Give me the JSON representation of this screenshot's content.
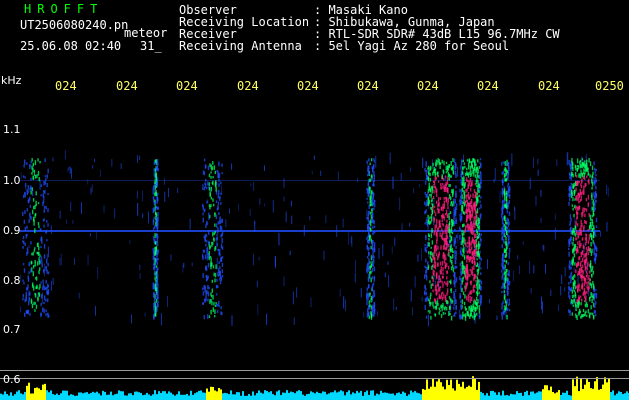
{
  "header": {
    "brand": "HROFFT",
    "filename": "UT2506080240.pn",
    "tag": "meteor",
    "datetime": "25.06.08 02:40",
    "count": "31_",
    "observer_label": "Observer",
    "observer_value": ": Masaki Kano",
    "location_label": "Receiving Location",
    "location_value": ": Shibukawa, Gunma, Japan",
    "receiver_label": "Receiver",
    "receiver_value": ": RTL-SDR SDR# 43dB L15 96.7MHz CW",
    "antenna_label": "Receiving Antenna",
    "antenna_value": ": 5el Yagi Az 280 for Seoul"
  },
  "spectrogram": {
    "unit_label": "kHz",
    "y_ticks": [
      "1.1",
      "1.0",
      "0.9",
      "0.8",
      "0.7",
      "0.6"
    ],
    "time_ticks": [
      "024",
      "024",
      "024",
      "024",
      "024",
      "024",
      "024",
      "024",
      "024",
      "0250"
    ],
    "colors": {
      "background": "#000000",
      "time_text": "#ffff66",
      "brand_text": "#00ff00",
      "signal_low": "#1f4fff",
      "signal_mid": "#00ff66",
      "signal_high": "#ff2080",
      "histogram": "#00d8ff",
      "histogram_peak": "#ffff00"
    }
  }
}
